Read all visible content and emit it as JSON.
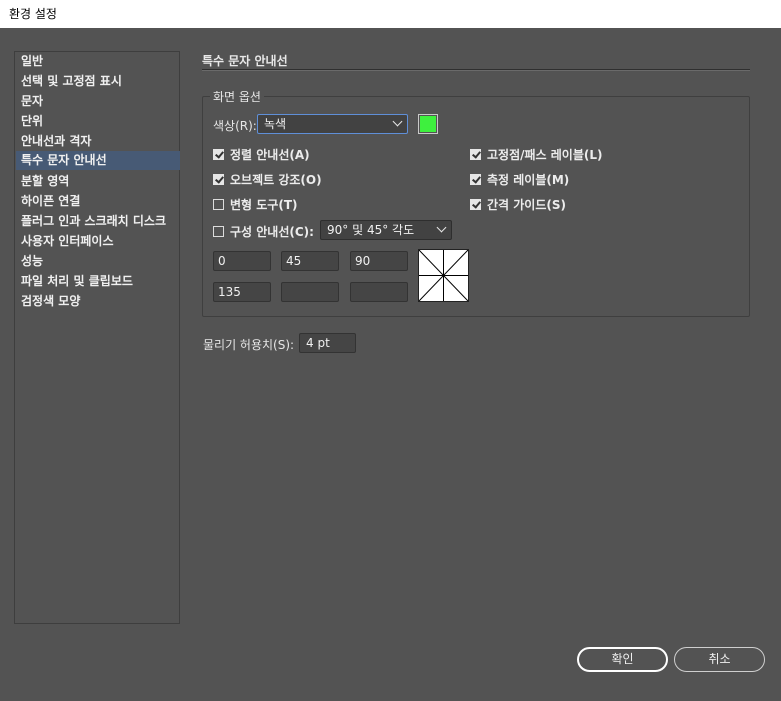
{
  "window": {
    "title": "환경 설정"
  },
  "sidebar": {
    "items": [
      {
        "label": "일반"
      },
      {
        "label": "선택 및 고정점 표시"
      },
      {
        "label": "문자"
      },
      {
        "label": "단위"
      },
      {
        "label": "안내선과 격자"
      },
      {
        "label": "특수 문자 안내선",
        "selected": true
      },
      {
        "label": "분할 영역"
      },
      {
        "label": "하이픈 연결"
      },
      {
        "label": "플러그 인과 스크래치 디스크"
      },
      {
        "label": "사용자 인터페이스"
      },
      {
        "label": "성능"
      },
      {
        "label": "파일 처리 및 클립보드"
      },
      {
        "label": "검정색 모양"
      }
    ]
  },
  "panel": {
    "title": "특수 문자 안내선",
    "display_options": {
      "legend": "화면 옵션",
      "color_label": "색상(R):",
      "color_value": "녹색",
      "swatch_color": "#3ef03e",
      "checkboxes": {
        "alignment_guides": {
          "label": "정렬 안내선(A)",
          "checked": true
        },
        "object_highlighting": {
          "label": "오브젝트 강조(O)",
          "checked": true
        },
        "transform_tools": {
          "label": "변형 도구(T)",
          "checked": false
        },
        "anchor_path_labels": {
          "label": "고정점/패스 레이블(L)",
          "checked": true
        },
        "measurement_labels": {
          "label": "측정 레이블(M)",
          "checked": true
        },
        "spacing_guides": {
          "label": "간격 가이드(S)",
          "checked": true
        },
        "construction_guides": {
          "label": "구성 안내선(C):",
          "checked": false
        }
      },
      "angle_select_value": "90° 및 45° 각도",
      "angles": [
        "0",
        "45",
        "90",
        "135",
        "",
        ""
      ]
    },
    "snapping_tolerance_label": "물리기 허용치(S):",
    "snapping_tolerance_value": "4 pt"
  },
  "buttons": {
    "ok": "확인",
    "cancel": "취소"
  }
}
